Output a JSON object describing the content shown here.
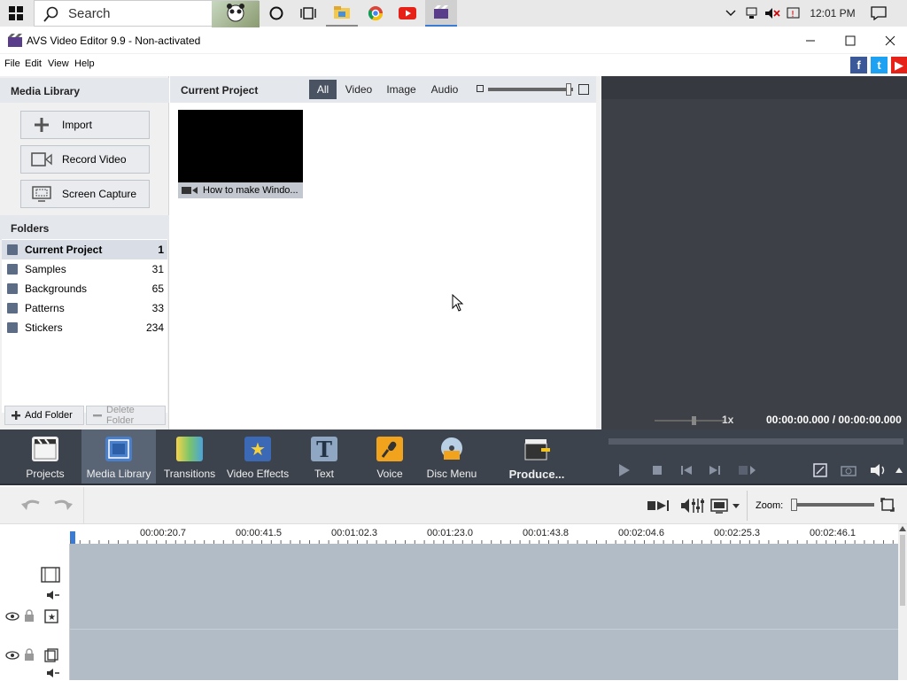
{
  "taskbar": {
    "search_placeholder": "Search",
    "clock": "12:01 PM"
  },
  "window": {
    "title": "AVS Video Editor 9.9 - Non-activated"
  },
  "menu": [
    "File",
    "Edit",
    "View",
    "Help"
  ],
  "media_library": {
    "header": "Media Library",
    "buttons": [
      {
        "label": "Import",
        "icon": "plus-icon"
      },
      {
        "label": "Record Video",
        "icon": "camera-icon"
      },
      {
        "label": "Screen Capture",
        "icon": "screen-capture-icon"
      }
    ],
    "folders_header": "Folders",
    "folders": [
      {
        "name": "Current Project",
        "count": "1"
      },
      {
        "name": "Samples",
        "count": "31"
      },
      {
        "name": "Backgrounds",
        "count": "65"
      },
      {
        "name": "Patterns",
        "count": "33"
      },
      {
        "name": "Stickers",
        "count": "234"
      }
    ],
    "add_folder": "Add Folder",
    "delete_folder": "Delete Folder"
  },
  "project": {
    "header": "Current Project",
    "filters": [
      "All",
      "Video",
      "Image",
      "Audio"
    ],
    "active_filter": "All",
    "items": [
      {
        "caption": "How to make Windo..."
      }
    ]
  },
  "preview": {
    "speed": "1x",
    "time": "00:00:00.000 / 00:00:00.000"
  },
  "toolbar": {
    "tools": [
      {
        "label": "Projects",
        "icon": "projects-icon"
      },
      {
        "label": "Media Library",
        "icon": "media-library-icon"
      },
      {
        "label": "Transitions",
        "icon": "transitions-icon"
      },
      {
        "label": "Video Effects",
        "icon": "video-effects-icon"
      },
      {
        "label": "Text",
        "icon": "text-icon"
      },
      {
        "label": "Voice",
        "icon": "microphone-icon"
      },
      {
        "label": "Disc Menu",
        "icon": "disc-menu-icon"
      },
      {
        "label": "Produce...",
        "icon": "produce-icon"
      }
    ],
    "active_tool": "Media Library"
  },
  "timeline": {
    "zoom_label": "Zoom:",
    "ruler": [
      "00:00:20.7",
      "00:00:41.5",
      "00:01:02.3",
      "00:01:23.0",
      "00:01:43.8",
      "00:02:04.6",
      "00:02:25.3",
      "00:02:46.1"
    ]
  }
}
